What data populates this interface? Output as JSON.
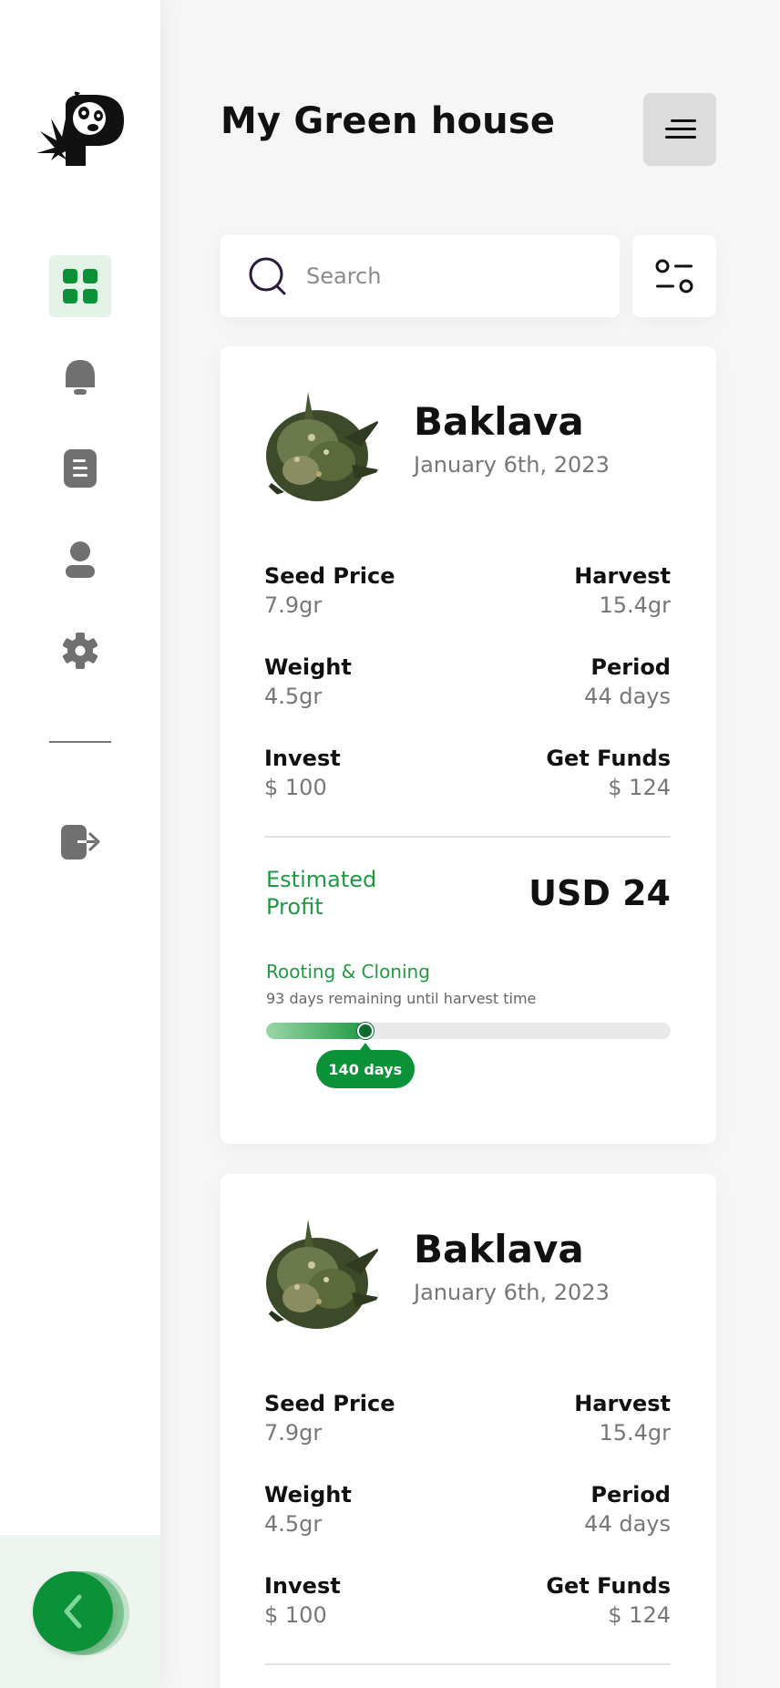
{
  "app": {
    "title": "My Green house"
  },
  "search": {
    "placeholder": "Search",
    "value": ""
  },
  "progress": {
    "fraction": 0.245
  },
  "colors": {
    "accent": "#0b9138",
    "accent_light": "#e4f3e8"
  },
  "sidebar": {
    "items": [
      {
        "icon": "dashboard-grid-icon",
        "active": true
      },
      {
        "icon": "bell-icon",
        "active": false
      },
      {
        "icon": "document-icon",
        "active": false
      },
      {
        "icon": "user-icon",
        "active": false
      },
      {
        "icon": "gear-icon",
        "active": false
      },
      {
        "icon": "logout-icon",
        "active": false
      }
    ],
    "back_icon": "chevron-left-icon"
  },
  "cards": [
    {
      "name": "Baklava",
      "date": "January 6th, 2023",
      "stats": {
        "seed_price_label": "Seed Price",
        "seed_price": "7.9gr",
        "harvest_label": "Harvest",
        "harvest": "15.4gr",
        "weight_label": "Weight",
        "weight": "4.5gr",
        "period_label": "Period",
        "period": "44 days",
        "invest_label": "Invest",
        "invest": "$ 100",
        "funds_label": "Get Funds",
        "funds": "$ 124"
      },
      "profit_label": "Estimated Profit",
      "profit_value": "USD 24",
      "stage": "Rooting & Cloning",
      "stage_sub": "93 days remaining until harvest time",
      "progress_badge": "140 days"
    },
    {
      "name": "Baklava",
      "date": "January 6th, 2023",
      "stats": {
        "seed_price_label": "Seed Price",
        "seed_price": "7.9gr",
        "harvest_label": "Harvest",
        "harvest": "15.4gr",
        "weight_label": "Weight",
        "weight": "4.5gr",
        "period_label": "Period",
        "period": "44 days",
        "invest_label": "Invest",
        "invest": "$ 100",
        "funds_label": "Get Funds",
        "funds": "$ 124"
      }
    }
  ]
}
